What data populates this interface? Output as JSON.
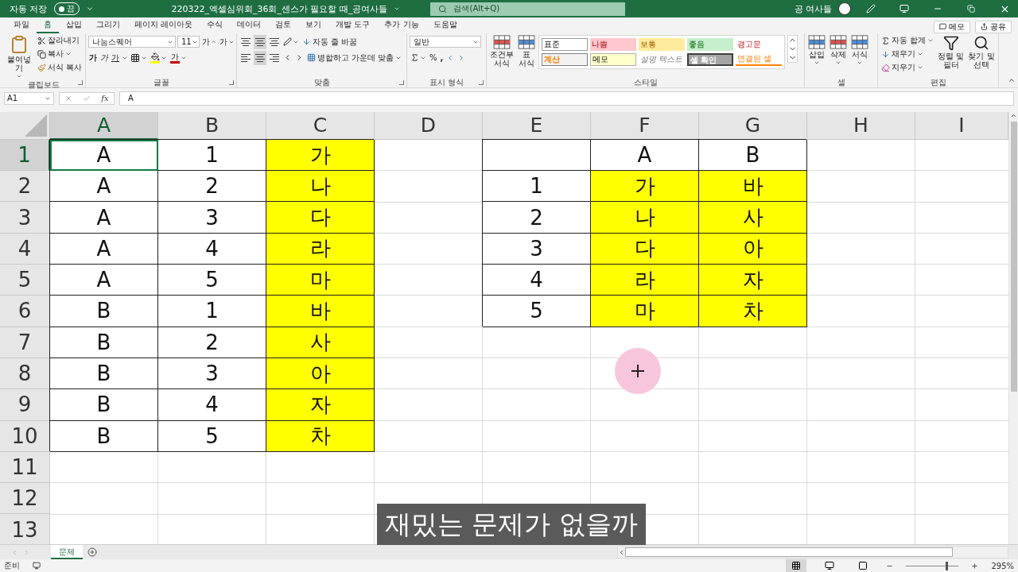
{
  "title_bar": {
    "autosave_label": "자동 저장",
    "autosave": {
      "on": false,
      "label": "끔"
    },
    "title": "220322_엑셀심위회_36회_센스가 필요할 때_공여사들",
    "search": {
      "placeholder": "검색(Alt+Q)"
    },
    "user": "공 여사들"
  },
  "tabs": [
    {
      "label": "파일",
      "selected": false
    },
    {
      "label": "홈",
      "selected": true
    },
    {
      "label": "삽입",
      "selected": false
    },
    {
      "label": "그리기",
      "selected": false
    },
    {
      "label": "페이지 레이아웃",
      "selected": false
    },
    {
      "label": "수식",
      "selected": false
    },
    {
      "label": "데이터",
      "selected": false
    },
    {
      "label": "검토",
      "selected": false
    },
    {
      "label": "보기",
      "selected": false
    },
    {
      "label": "개발 도구",
      "selected": false
    },
    {
      "label": "추가 기능",
      "selected": false
    },
    {
      "label": "도움말",
      "selected": false
    }
  ],
  "tab_actions": [
    "메모",
    "공유"
  ],
  "ribbon": {
    "clipboard": {
      "label": "클립보드",
      "paste": "붙여넣기",
      "cut": "잘라내기",
      "copy": "복사",
      "format_painter": "서식 복사"
    },
    "font": {
      "label": "글꼴",
      "font_name": "나눔스퀘어",
      "font_size": "11",
      "grow": "가",
      "shrink": "가",
      "bold": "가",
      "italic": "가",
      "underline": "가",
      "font_color": "가"
    },
    "alignment": {
      "label": "맞춤",
      "wrap_text": "자동 줄 바꿈",
      "merge_center": "병합하고 가운데 맞춤"
    },
    "number": {
      "label": "표시 형식",
      "format": "일반",
      "percent": "%",
      "comma": ","
    },
    "styles": {
      "label": "스타일",
      "conditional_formatting": "조건부\n서식",
      "format_as_table": "표\n서식",
      "gallery": [
        {
          "label": "표준",
          "kind": "normal"
        },
        {
          "label": "나쁨",
          "kind": "bad"
        },
        {
          "label": "보통",
          "kind": "neutral"
        },
        {
          "label": "좋음",
          "kind": "good"
        },
        {
          "label": "경고문",
          "kind": "warning"
        },
        {
          "label": "계산",
          "kind": "calculation"
        },
        {
          "label": "메모",
          "kind": "note"
        },
        {
          "label": "설명 텍스트",
          "kind": "explanatory"
        },
        {
          "label": "셀 확인",
          "kind": "check"
        },
        {
          "label": "연결된 셀",
          "kind": "linked"
        }
      ]
    },
    "cells": {
      "label": "셀",
      "insert": "삽입",
      "delete": "삭제",
      "format": "서식"
    },
    "editing": {
      "label": "편집",
      "autosum": "자동 합계",
      "fill": "채우기",
      "clear": "지우기",
      "sort_filter": "정렬 및\n필터",
      "find_select": "찾기 및\n선택"
    }
  },
  "formula_bar": {
    "name_box": "A1",
    "function_label": "fx",
    "content": "A"
  },
  "columns": [
    {
      "label": "A",
      "selected": true
    },
    {
      "label": "B",
      "selected": false
    },
    {
      "label": "C",
      "selected": false
    },
    {
      "label": "D",
      "selected": false
    },
    {
      "label": "E",
      "selected": false
    },
    {
      "label": "F",
      "selected": false
    },
    {
      "label": "G",
      "selected": false
    },
    {
      "label": "H",
      "selected": false
    },
    {
      "label": "I",
      "selected": false
    }
  ],
  "rows": [
    {
      "label": "1",
      "selected": true,
      "cells": [
        {
          "text": "A",
          "highlighted": false
        },
        {
          "text": "1",
          "highlighted": false
        },
        {
          "text": "가",
          "highlighted": true
        },
        null,
        {
          "highlighted": false
        },
        {
          "text": "A",
          "highlighted": false
        },
        {
          "text": "B",
          "highlighted": false
        }
      ]
    },
    {
      "label": "2",
      "selected": false,
      "cells": [
        {
          "text": "A",
          "highlighted": false
        },
        {
          "text": "2",
          "highlighted": false
        },
        {
          "text": "나",
          "highlighted": true
        },
        null,
        {
          "text": "1",
          "highlighted": false
        },
        {
          "text": "가",
          "highlighted": true
        },
        {
          "text": "바",
          "highlighted": true
        }
      ]
    },
    {
      "label": "3",
      "selected": false,
      "cells": [
        {
          "text": "A",
          "highlighted": false
        },
        {
          "text": "3",
          "highlighted": false
        },
        {
          "text": "다",
          "highlighted": true
        },
        null,
        {
          "text": "2",
          "highlighted": false
        },
        {
          "text": "나",
          "highlighted": true
        },
        {
          "text": "사",
          "highlighted": true
        }
      ]
    },
    {
      "label": "4",
      "selected": false,
      "cells": [
        {
          "text": "A",
          "highlighted": false
        },
        {
          "text": "4",
          "highlighted": false
        },
        {
          "text": "라",
          "highlighted": true
        },
        null,
        {
          "text": "3",
          "highlighted": false
        },
        {
          "text": "다",
          "highlighted": true
        },
        {
          "text": "아",
          "highlighted": true
        }
      ]
    },
    {
      "label": "5",
      "selected": false,
      "cells": [
        {
          "text": "A",
          "highlighted": false
        },
        {
          "text": "5",
          "highlighted": false
        },
        {
          "text": "마",
          "highlighted": true
        },
        null,
        {
          "text": "4",
          "highlighted": false
        },
        {
          "text": "라",
          "highlighted": true
        },
        {
          "text": "자",
          "highlighted": true
        }
      ]
    },
    {
      "label": "6",
      "selected": false,
      "cells": [
        {
          "text": "B",
          "highlighted": false
        },
        {
          "text": "1",
          "highlighted": false
        },
        {
          "text": "바",
          "highlighted": true
        },
        null,
        {
          "text": "5",
          "highlighted": false
        },
        {
          "text": "마",
          "highlighted": true
        },
        {
          "text": "차",
          "highlighted": true
        }
      ]
    },
    {
      "label": "7",
      "selected": false,
      "cells": [
        {
          "text": "B",
          "highlighted": false
        },
        {
          "text": "2",
          "highlighted": false
        },
        {
          "text": "사",
          "highlighted": true
        }
      ]
    },
    {
      "label": "8",
      "selected": false,
      "cells": [
        {
          "text": "B",
          "highlighted": false
        },
        {
          "text": "3",
          "highlighted": false
        },
        {
          "text": "아",
          "highlighted": true
        }
      ]
    },
    {
      "label": "9",
      "selected": false,
      "cells": [
        {
          "text": "B",
          "highlighted": false
        },
        {
          "text": "4",
          "highlighted": false
        },
        {
          "text": "자",
          "highlighted": true
        }
      ]
    },
    {
      "label": "10",
      "selected": false,
      "cells": [
        {
          "text": "B",
          "highlighted": false
        },
        {
          "text": "5",
          "highlighted": false
        },
        {
          "text": "차",
          "highlighted": true
        }
      ]
    },
    {
      "label": "11",
      "selected": false
    },
    {
      "label": "12",
      "selected": false
    },
    {
      "label": "13",
      "selected": false
    }
  ],
  "sheet_tabs": [
    {
      "label": "문제",
      "selected": true
    }
  ],
  "subtitle": "재밌는 문제가 없을까",
  "status_bar": {
    "status": "준비",
    "views": [
      {
        "kind": "normal",
        "selected": true
      },
      {
        "kind": "page_layout",
        "selected": false
      },
      {
        "kind": "page_break",
        "selected": false
      }
    ],
    "zoom": {
      "level": 0.8,
      "reading": "295%"
    }
  }
}
